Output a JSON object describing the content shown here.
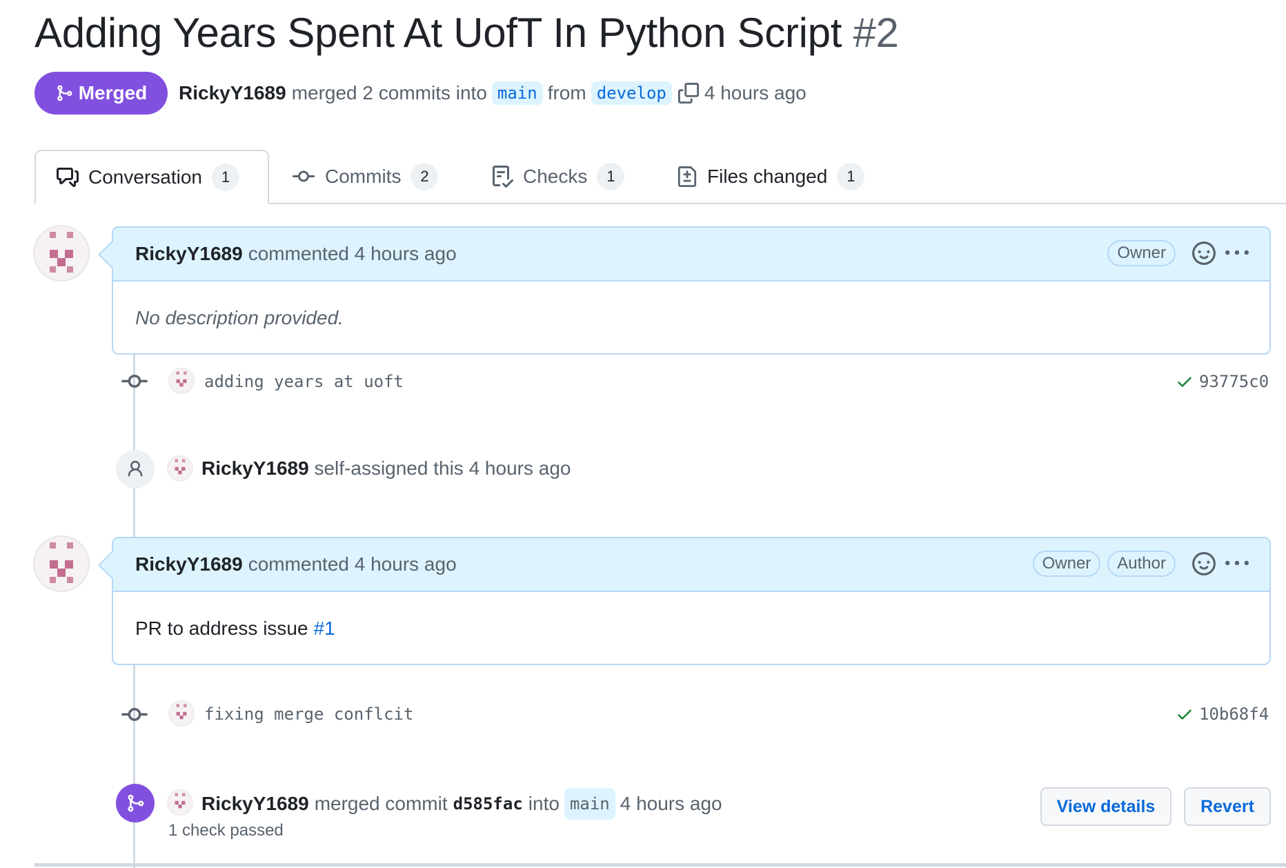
{
  "pr": {
    "title": "Adding Years Spent At UofT In Python Script",
    "number": "#2",
    "state": "Merged",
    "author": "RickyY1689",
    "merge_text": "merged 2 commits into",
    "base_branch": "main",
    "from_text": "from",
    "head_branch": "develop",
    "time": "4 hours ago"
  },
  "tabs": [
    {
      "label": "Conversation",
      "count": "1"
    },
    {
      "label": "Commits",
      "count": "2"
    },
    {
      "label": "Checks",
      "count": "1"
    },
    {
      "label": "Files changed",
      "count": "1"
    }
  ],
  "comment1": {
    "author": "RickyY1689",
    "action": "commented 4 hours ago",
    "badges": [
      "Owner"
    ],
    "body": "No description provided."
  },
  "commit1": {
    "message": "adding years at uoft",
    "sha": "93775c0"
  },
  "event_assign": {
    "author": "RickyY1689",
    "text": "self-assigned this 4 hours ago"
  },
  "comment2": {
    "author": "RickyY1689",
    "action": "commented 4 hours ago",
    "badges": [
      "Owner",
      "Author"
    ],
    "body_text": "PR to address issue",
    "body_link": "#1"
  },
  "commit2": {
    "message": "fixing merge conflcit",
    "sha": "10b68f4"
  },
  "event_merge": {
    "author": "RickyY1689",
    "text": "merged commit",
    "sha": "d585fac",
    "into": "into",
    "branch": "main",
    "time": "4 hours ago",
    "checks": "1 check passed",
    "view_details": "View details",
    "revert": "Revert"
  },
  "colors": {
    "merged": "#8250df",
    "link": "#0969da",
    "success": "#1a7f37"
  }
}
